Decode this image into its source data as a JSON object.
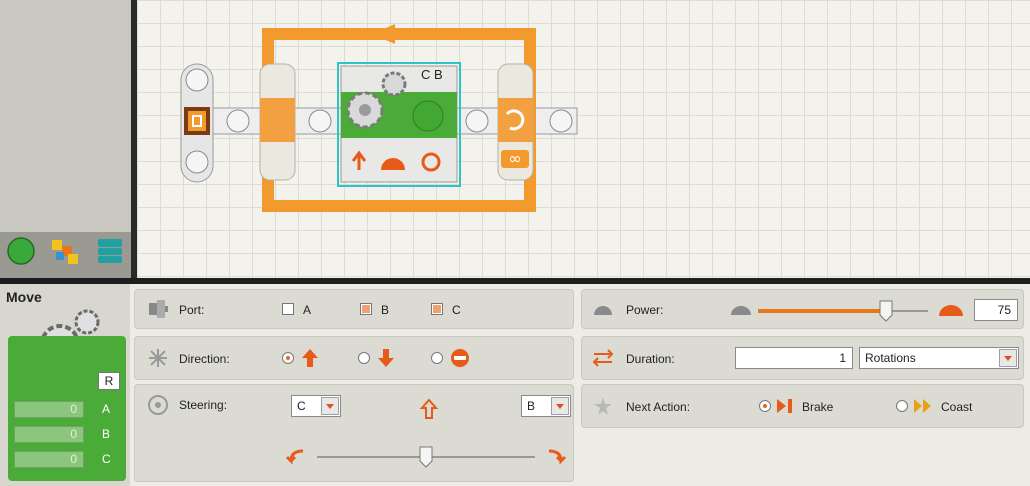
{
  "palette_tabs": [
    {
      "icon": "common-palette-icon",
      "color": "#3aa83a"
    },
    {
      "icon": "complete-palette-icon",
      "color": "#e8a818"
    },
    {
      "icon": "custom-palette-icon",
      "color": "#20a0a0"
    }
  ],
  "program": {
    "loop_icon": "infinite-loop-icon",
    "move_block_ports": "C B",
    "loop_count_icon": "infinity-icon"
  },
  "block": {
    "title": "Move",
    "r_label": "R",
    "ports": [
      {
        "letter": "A",
        "value": "0"
      },
      {
        "letter": "B",
        "value": "0"
      },
      {
        "letter": "C",
        "value": "0"
      }
    ]
  },
  "port": {
    "label": "Port:",
    "options": [
      {
        "name": "A",
        "checked": false
      },
      {
        "name": "B",
        "checked": true
      },
      {
        "name": "C",
        "checked": true
      }
    ]
  },
  "direction": {
    "label": "Direction:",
    "options": [
      "forward",
      "backward",
      "stop"
    ],
    "selected": "forward"
  },
  "steering": {
    "label": "Steering:",
    "left_motor": "C",
    "right_motor": "B",
    "slider_fraction": 0.5
  },
  "power": {
    "label": "Power:",
    "value": "75",
    "slider_fraction": 0.75
  },
  "duration": {
    "label": "Duration:",
    "value": "1",
    "unit": "Rotations"
  },
  "next_action": {
    "label": "Next Action:",
    "brake_label": "Brake",
    "coast_label": "Coast",
    "selected": "Brake"
  },
  "colors": {
    "accent": "#f29a2e",
    "green": "#4bab39",
    "select_cyan": "#2cc4c4"
  }
}
